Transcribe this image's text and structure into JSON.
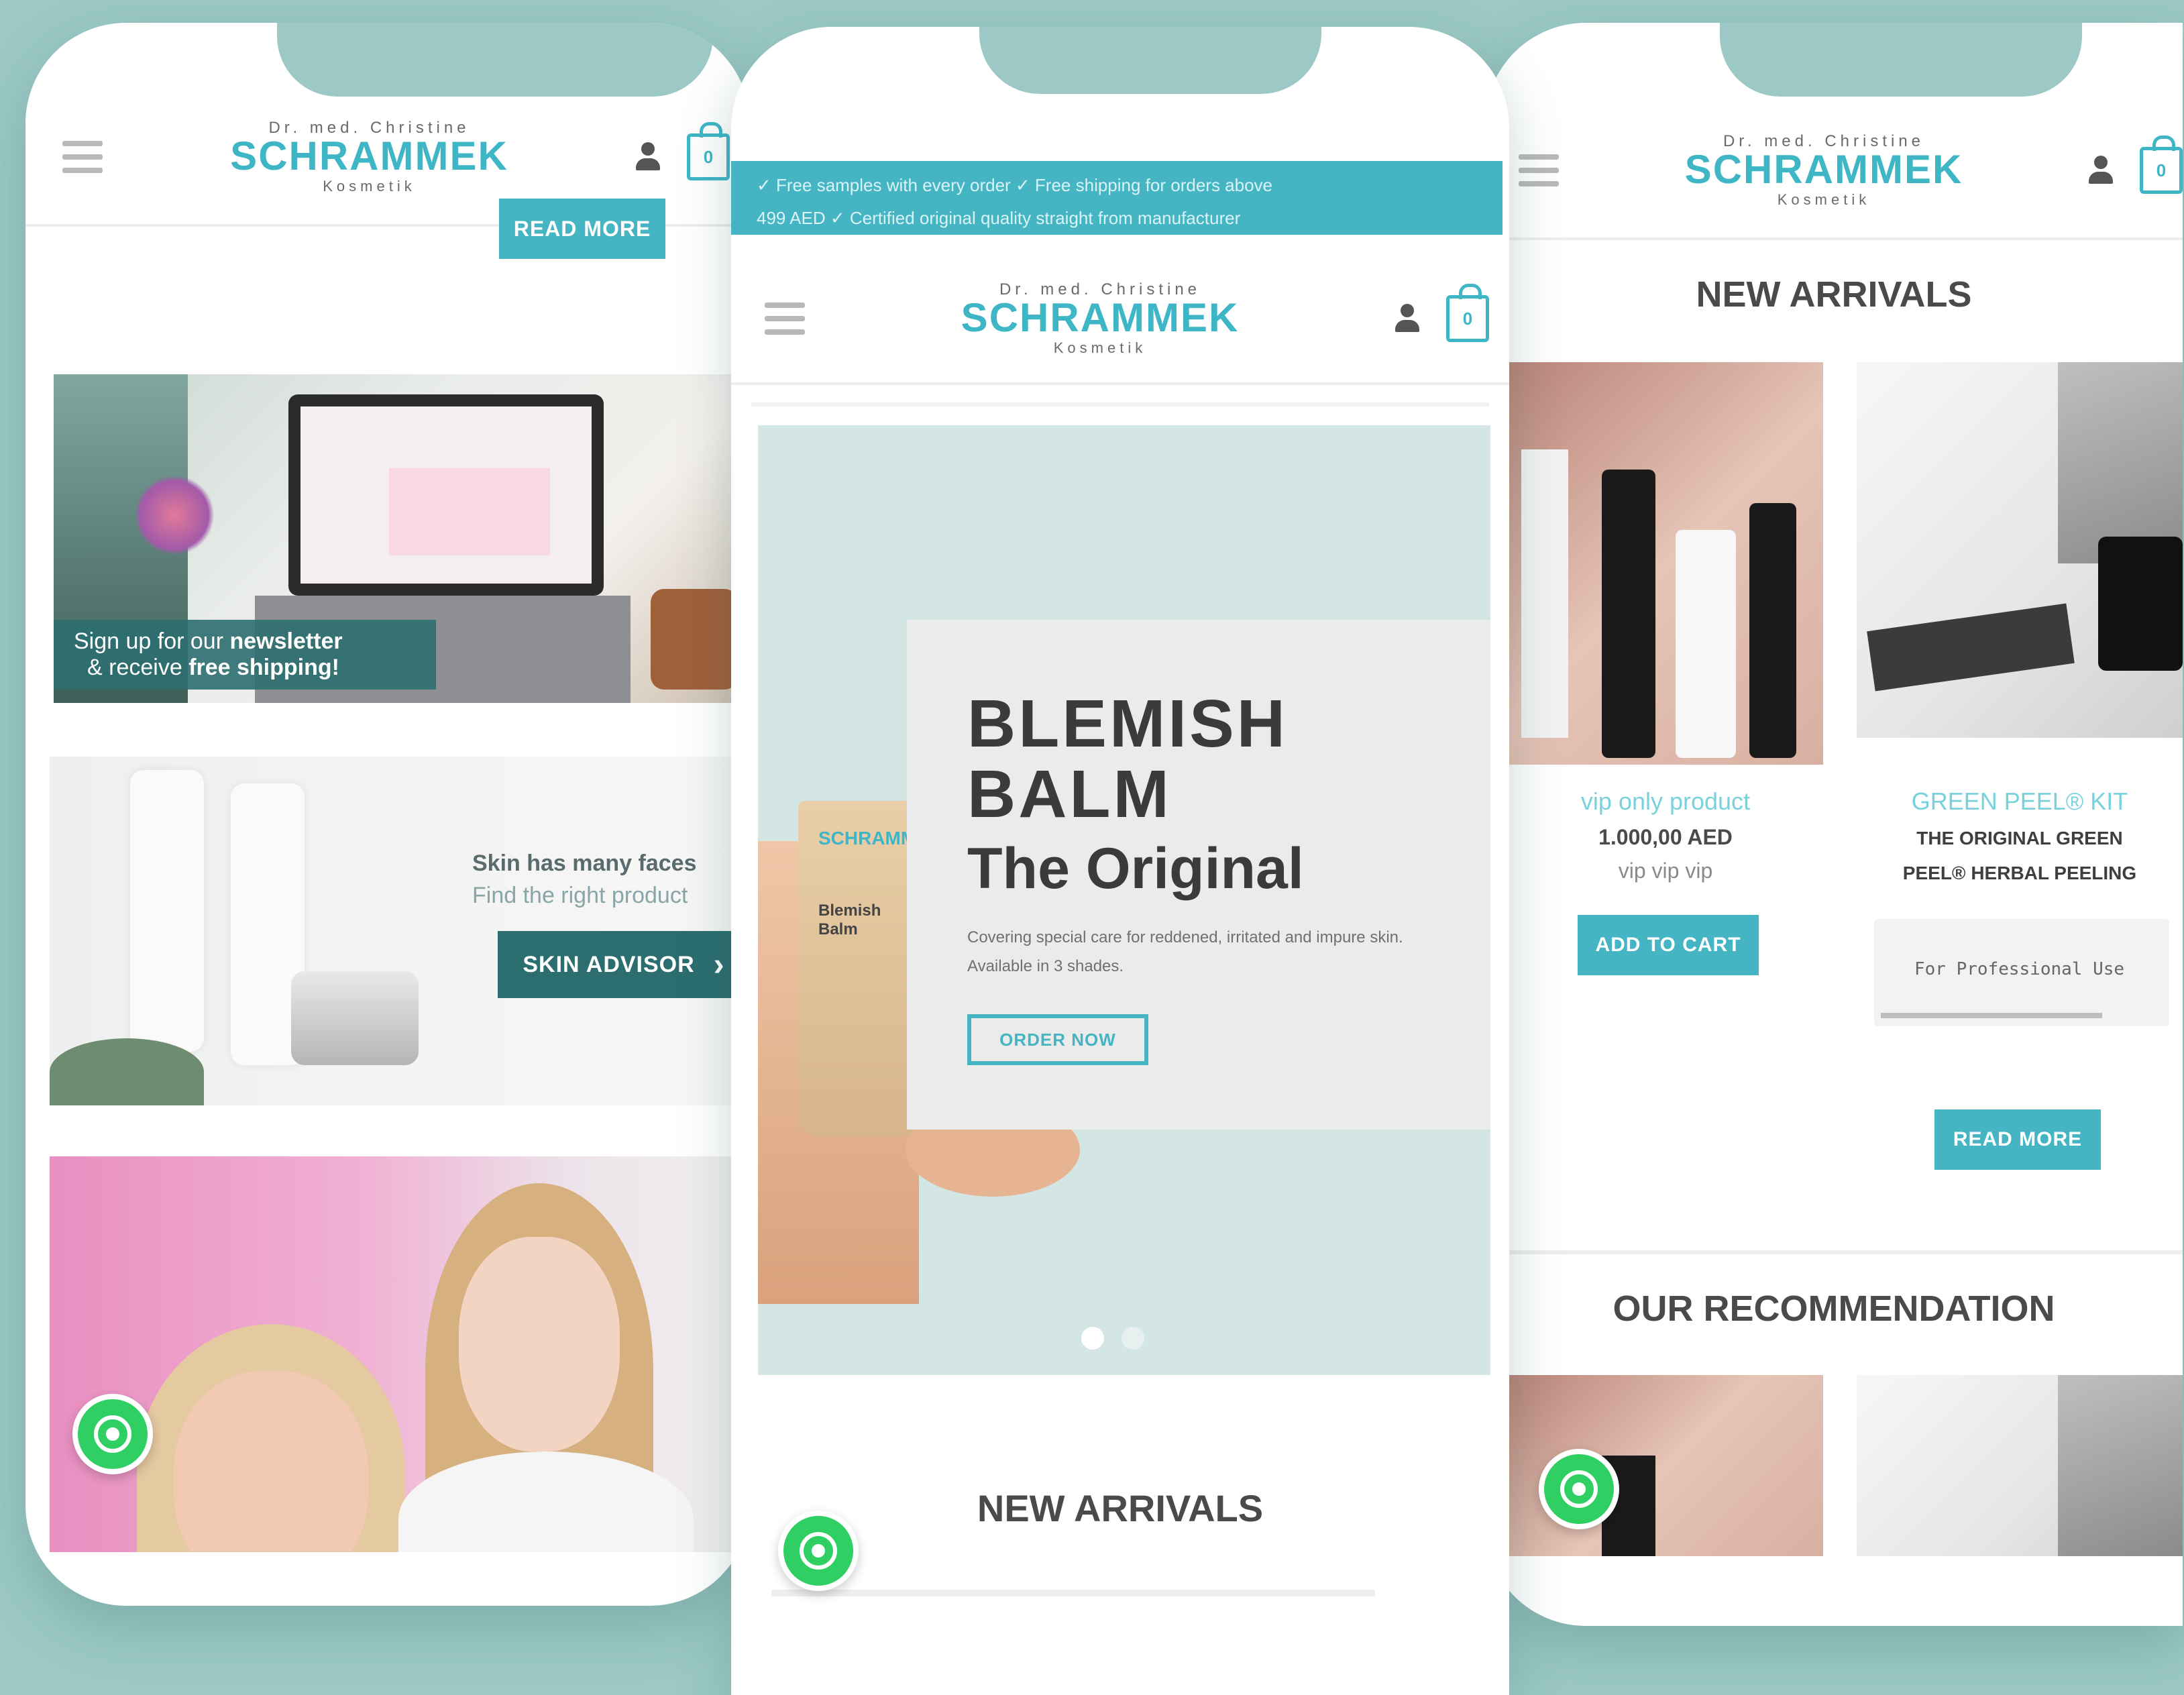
{
  "brand": {
    "logo_small": "Dr. med. Christine",
    "logo_big": "SCHRAMMEK",
    "logo_sub": "Kosmetik",
    "accent": "#45b5c4"
  },
  "cart": {
    "count": "0"
  },
  "left_phone": {
    "read_more_label": "READ MORE",
    "newsletter_line1_a": "Sign up for our ",
    "newsletter_line1_b": "newsletter",
    "newsletter_line2_a": "& receive ",
    "newsletter_line2_b": "free shipping!",
    "skin_line1": "Skin has many faces",
    "skin_line2": "Find the right product",
    "skin_advisor_label": "SKIN ADVISOR",
    "skin_advisor_arrow": "›"
  },
  "center_phone": {
    "promo_line1": "✓ Free samples with every order ✓ Free shipping for orders above",
    "promo_line2": "499 AED ✓ Certified original quality straight from manufacturer",
    "hero_title_1": "BLEMISH",
    "hero_title_2": "BALM",
    "hero_subtitle": "The Original",
    "hero_desc": "Covering special care for reddened, irritated and impure skin. Available in 3 shades.",
    "hero_button": "ORDER NOW",
    "product_tube_brand": "SCHRAMMEK",
    "product_tube_name": "Blemish Balm",
    "new_arrivals_title": "NEW ARRIVALS"
  },
  "right_phone": {
    "new_arrivals_title": "NEW ARRIVALS",
    "product1_name": "vip only product",
    "product1_price": "1.000,00 AED",
    "product1_note": "vip vip vip",
    "product1_button": "ADD TO CART",
    "product2_name": "GREEN PEEL® KIT",
    "product2_desc_1": "THE ORIGINAL GREEN",
    "product2_desc_2": "PEEL® HERBAL PEELING",
    "product2_field": "For Professional Use",
    "read_more_label": "READ MORE",
    "recommendation_title": "OUR RECOMMENDATION"
  }
}
